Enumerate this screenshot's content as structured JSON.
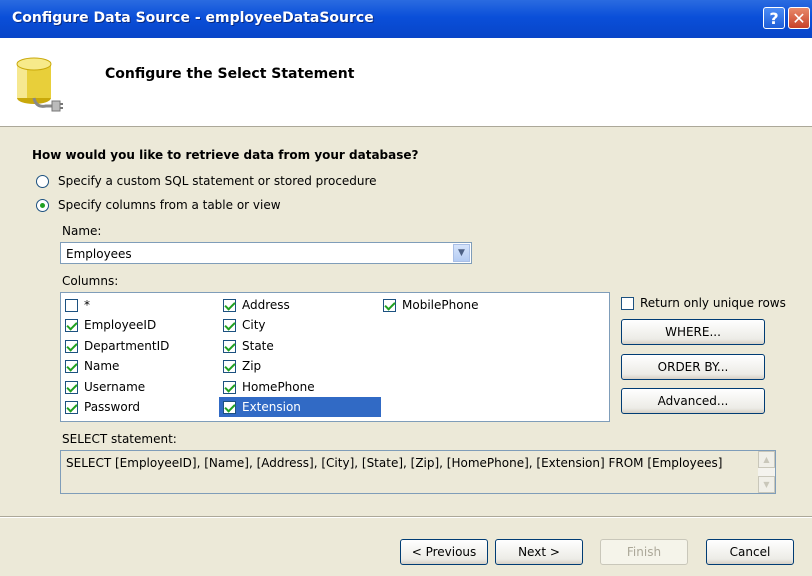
{
  "window": {
    "title": "Configure Data Source - employeeDataSource",
    "help_glyph": "?",
    "close_glyph": "✕"
  },
  "header": {
    "heading": "Configure the Select Statement",
    "icon": "database-icon"
  },
  "body": {
    "question": "How would you like to retrieve data from your database?",
    "options": [
      {
        "label": "Specify a custom SQL statement or stored procedure",
        "selected": false
      },
      {
        "label": "Specify columns from a table or view",
        "selected": true
      }
    ],
    "name_label": "Name:",
    "table_name": "Employees",
    "columns_label": "Columns:",
    "columns": [
      {
        "label": "*",
        "checked": false
      },
      {
        "label": "EmployeeID",
        "checked": true
      },
      {
        "label": "DepartmentID",
        "checked": true
      },
      {
        "label": "Name",
        "checked": true
      },
      {
        "label": "Username",
        "checked": true
      },
      {
        "label": "Password",
        "checked": true
      },
      {
        "label": "Address",
        "checked": true
      },
      {
        "label": "City",
        "checked": true
      },
      {
        "label": "State",
        "checked": true
      },
      {
        "label": "Zip",
        "checked": true
      },
      {
        "label": "HomePhone",
        "checked": true
      },
      {
        "label": "Extension",
        "checked": true,
        "selected": true
      },
      {
        "label": "MobilePhone",
        "checked": true
      }
    ],
    "unique_rows_label": "Return only unique rows",
    "unique_rows_checked": false,
    "side_buttons": {
      "where": "WHERE...",
      "order_by": "ORDER BY...",
      "advanced": "Advanced..."
    },
    "select_label": "SELECT statement:",
    "select_statement": "SELECT [EmployeeID], [Name], [Address], [City], [State], [Zip], [HomePhone], [Extension] FROM [Employees]"
  },
  "footer": {
    "previous": "< Previous",
    "next": "Next >",
    "finish": "Finish",
    "cancel": "Cancel"
  }
}
